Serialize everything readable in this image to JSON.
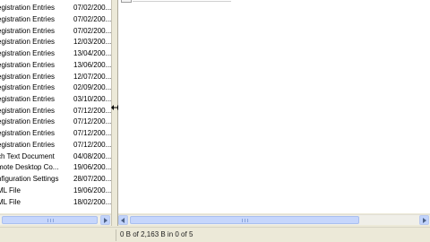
{
  "file_list": {
    "rows": [
      {
        "type": "egistration Entries",
        "date": "07/02/200..."
      },
      {
        "type": "egistration Entries",
        "date": "07/02/200..."
      },
      {
        "type": "egistration Entries",
        "date": "07/02/200..."
      },
      {
        "type": "egistration Entries",
        "date": "12/03/200..."
      },
      {
        "type": "egistration Entries",
        "date": "13/04/200..."
      },
      {
        "type": "egistration Entries",
        "date": "13/06/200..."
      },
      {
        "type": "egistration Entries",
        "date": "12/07/200..."
      },
      {
        "type": "egistration Entries",
        "date": "02/09/200..."
      },
      {
        "type": "egistration Entries",
        "date": "03/10/200..."
      },
      {
        "type": "egistration Entries",
        "date": "07/12/200..."
      },
      {
        "type": "egistration Entries",
        "date": "07/12/200..."
      },
      {
        "type": "egistration Entries",
        "date": "07/12/200..."
      },
      {
        "type": "egistration Entries",
        "date": "07/12/200..."
      },
      {
        "type": "ch Text Document",
        "date": "04/08/200..."
      },
      {
        "type": "mote Desktop Co...",
        "date": "19/06/200..."
      },
      {
        "type": "nfiguration Settings",
        "date": "28/07/200..."
      },
      {
        "type": "ML File",
        "date": "19/06/200..."
      },
      {
        "type": "ML File",
        "date": "18/02/200..."
      }
    ]
  },
  "status_bar": {
    "text": "0 B of 2,163 B in 0 of 5"
  },
  "icons": {
    "splitter": "splitter-arrows-icon",
    "scroll_left": "chevron-left-icon",
    "scroll_right": "chevron-right-icon"
  }
}
